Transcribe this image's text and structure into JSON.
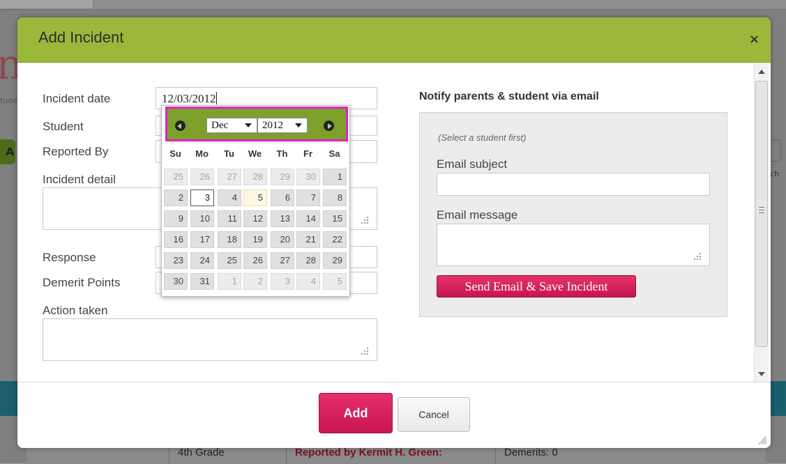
{
  "background": {
    "logo_fragment": "nc",
    "small_text": "tude",
    "green_button_letter": "A",
    "right_link_fragment": "ch",
    "row_cells": [
      "4th Grade",
      "Reported by Kermit H. Green:",
      "Demerits: 0"
    ]
  },
  "modal": {
    "title": "Add Incident",
    "close_label": "×",
    "colors": {
      "header": "#9ab93b",
      "primary": "#d01d58"
    }
  },
  "form": {
    "incident_date_label": "Incident date",
    "incident_date_value": "12/03/2012",
    "student_label": "Student",
    "reported_by_label": "Reported By",
    "incident_detail_label": "Incident detail",
    "response_label": "Response",
    "demerit_points_label": "Demerit Points",
    "action_taken_label": "Action taken"
  },
  "notify": {
    "title": "Notify parents & student via email",
    "hint": "(Select a student first)",
    "subject_label": "Email subject",
    "message_label": "Email message",
    "send_label": "Send Email & Save Incident"
  },
  "datepicker": {
    "month": "Dec",
    "year": "2012",
    "weekdays": [
      "Su",
      "Mo",
      "Tu",
      "We",
      "Th",
      "Fr",
      "Sa"
    ],
    "weeks": [
      [
        {
          "d": "25",
          "o": true
        },
        {
          "d": "26",
          "o": true
        },
        {
          "d": "27",
          "o": true
        },
        {
          "d": "28",
          "o": true
        },
        {
          "d": "29",
          "o": true
        },
        {
          "d": "30",
          "o": true
        },
        {
          "d": "1"
        }
      ],
      [
        {
          "d": "2"
        },
        {
          "d": "3",
          "active": true
        },
        {
          "d": "4"
        },
        {
          "d": "5",
          "today": true
        },
        {
          "d": "6"
        },
        {
          "d": "7"
        },
        {
          "d": "8"
        }
      ],
      [
        {
          "d": "9"
        },
        {
          "d": "10"
        },
        {
          "d": "11"
        },
        {
          "d": "12"
        },
        {
          "d": "13"
        },
        {
          "d": "14"
        },
        {
          "d": "15"
        }
      ],
      [
        {
          "d": "16"
        },
        {
          "d": "17"
        },
        {
          "d": "18"
        },
        {
          "d": "19"
        },
        {
          "d": "20"
        },
        {
          "d": "21"
        },
        {
          "d": "22"
        }
      ],
      [
        {
          "d": "23"
        },
        {
          "d": "24"
        },
        {
          "d": "25"
        },
        {
          "d": "26"
        },
        {
          "d": "27"
        },
        {
          "d": "28"
        },
        {
          "d": "29"
        }
      ],
      [
        {
          "d": "30"
        },
        {
          "d": "31"
        },
        {
          "d": "1",
          "o": true
        },
        {
          "d": "2",
          "o": true
        },
        {
          "d": "3",
          "o": true
        },
        {
          "d": "4",
          "o": true
        },
        {
          "d": "5",
          "o": true
        }
      ]
    ],
    "highlight_color": "#e020c8"
  },
  "footer": {
    "add_label": "Add",
    "cancel_label": "Cancel"
  },
  "icons": [
    "close-icon",
    "prev-month-icon",
    "next-month-icon",
    "dropdown-arrow-icon",
    "resize-grip-icon",
    "scroll-up-icon",
    "scroll-down-icon"
  ]
}
